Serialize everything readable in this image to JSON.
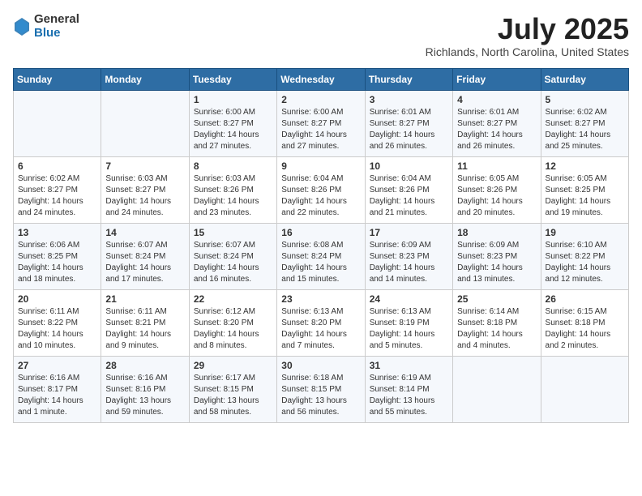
{
  "header": {
    "logo_general": "General",
    "logo_blue": "Blue",
    "month_title": "July 2025",
    "location": "Richlands, North Carolina, United States"
  },
  "weekdays": [
    "Sunday",
    "Monday",
    "Tuesday",
    "Wednesday",
    "Thursday",
    "Friday",
    "Saturday"
  ],
  "weeks": [
    [
      {
        "day": "",
        "info": ""
      },
      {
        "day": "",
        "info": ""
      },
      {
        "day": "1",
        "info": "Sunrise: 6:00 AM\nSunset: 8:27 PM\nDaylight: 14 hours and 27 minutes."
      },
      {
        "day": "2",
        "info": "Sunrise: 6:00 AM\nSunset: 8:27 PM\nDaylight: 14 hours and 27 minutes."
      },
      {
        "day": "3",
        "info": "Sunrise: 6:01 AM\nSunset: 8:27 PM\nDaylight: 14 hours and 26 minutes."
      },
      {
        "day": "4",
        "info": "Sunrise: 6:01 AM\nSunset: 8:27 PM\nDaylight: 14 hours and 26 minutes."
      },
      {
        "day": "5",
        "info": "Sunrise: 6:02 AM\nSunset: 8:27 PM\nDaylight: 14 hours and 25 minutes."
      }
    ],
    [
      {
        "day": "6",
        "info": "Sunrise: 6:02 AM\nSunset: 8:27 PM\nDaylight: 14 hours and 24 minutes."
      },
      {
        "day": "7",
        "info": "Sunrise: 6:03 AM\nSunset: 8:27 PM\nDaylight: 14 hours and 24 minutes."
      },
      {
        "day": "8",
        "info": "Sunrise: 6:03 AM\nSunset: 8:26 PM\nDaylight: 14 hours and 23 minutes."
      },
      {
        "day": "9",
        "info": "Sunrise: 6:04 AM\nSunset: 8:26 PM\nDaylight: 14 hours and 22 minutes."
      },
      {
        "day": "10",
        "info": "Sunrise: 6:04 AM\nSunset: 8:26 PM\nDaylight: 14 hours and 21 minutes."
      },
      {
        "day": "11",
        "info": "Sunrise: 6:05 AM\nSunset: 8:26 PM\nDaylight: 14 hours and 20 minutes."
      },
      {
        "day": "12",
        "info": "Sunrise: 6:05 AM\nSunset: 8:25 PM\nDaylight: 14 hours and 19 minutes."
      }
    ],
    [
      {
        "day": "13",
        "info": "Sunrise: 6:06 AM\nSunset: 8:25 PM\nDaylight: 14 hours and 18 minutes."
      },
      {
        "day": "14",
        "info": "Sunrise: 6:07 AM\nSunset: 8:24 PM\nDaylight: 14 hours and 17 minutes."
      },
      {
        "day": "15",
        "info": "Sunrise: 6:07 AM\nSunset: 8:24 PM\nDaylight: 14 hours and 16 minutes."
      },
      {
        "day": "16",
        "info": "Sunrise: 6:08 AM\nSunset: 8:24 PM\nDaylight: 14 hours and 15 minutes."
      },
      {
        "day": "17",
        "info": "Sunrise: 6:09 AM\nSunset: 8:23 PM\nDaylight: 14 hours and 14 minutes."
      },
      {
        "day": "18",
        "info": "Sunrise: 6:09 AM\nSunset: 8:23 PM\nDaylight: 14 hours and 13 minutes."
      },
      {
        "day": "19",
        "info": "Sunrise: 6:10 AM\nSunset: 8:22 PM\nDaylight: 14 hours and 12 minutes."
      }
    ],
    [
      {
        "day": "20",
        "info": "Sunrise: 6:11 AM\nSunset: 8:22 PM\nDaylight: 14 hours and 10 minutes."
      },
      {
        "day": "21",
        "info": "Sunrise: 6:11 AM\nSunset: 8:21 PM\nDaylight: 14 hours and 9 minutes."
      },
      {
        "day": "22",
        "info": "Sunrise: 6:12 AM\nSunset: 8:20 PM\nDaylight: 14 hours and 8 minutes."
      },
      {
        "day": "23",
        "info": "Sunrise: 6:13 AM\nSunset: 8:20 PM\nDaylight: 14 hours and 7 minutes."
      },
      {
        "day": "24",
        "info": "Sunrise: 6:13 AM\nSunset: 8:19 PM\nDaylight: 14 hours and 5 minutes."
      },
      {
        "day": "25",
        "info": "Sunrise: 6:14 AM\nSunset: 8:18 PM\nDaylight: 14 hours and 4 minutes."
      },
      {
        "day": "26",
        "info": "Sunrise: 6:15 AM\nSunset: 8:18 PM\nDaylight: 14 hours and 2 minutes."
      }
    ],
    [
      {
        "day": "27",
        "info": "Sunrise: 6:16 AM\nSunset: 8:17 PM\nDaylight: 14 hours and 1 minute."
      },
      {
        "day": "28",
        "info": "Sunrise: 6:16 AM\nSunset: 8:16 PM\nDaylight: 13 hours and 59 minutes."
      },
      {
        "day": "29",
        "info": "Sunrise: 6:17 AM\nSunset: 8:15 PM\nDaylight: 13 hours and 58 minutes."
      },
      {
        "day": "30",
        "info": "Sunrise: 6:18 AM\nSunset: 8:15 PM\nDaylight: 13 hours and 56 minutes."
      },
      {
        "day": "31",
        "info": "Sunrise: 6:19 AM\nSunset: 8:14 PM\nDaylight: 13 hours and 55 minutes."
      },
      {
        "day": "",
        "info": ""
      },
      {
        "day": "",
        "info": ""
      }
    ]
  ]
}
